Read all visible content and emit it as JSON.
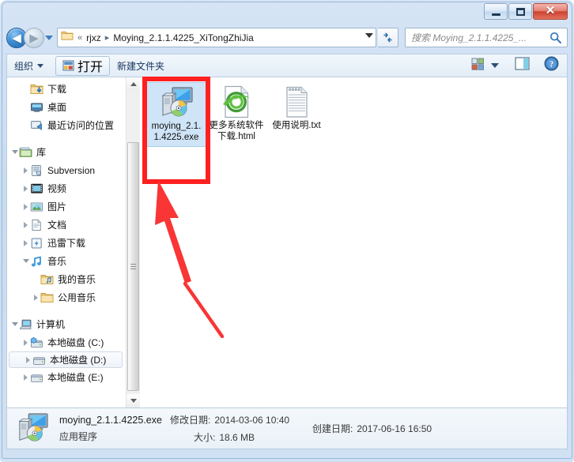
{
  "window": {
    "title": "",
    "controls": {
      "minimize": "minimize-button",
      "maximize": "maximize-button",
      "close": "✕"
    }
  },
  "address_bar": {
    "back_glyph": "◀",
    "forward_glyph": "▶",
    "separator": "«",
    "crumb_sep": "▸",
    "crumbs": [
      "rjxz",
      "Moying_2.1.1.4225_XiTongZhiJia"
    ],
    "refresh_glyph": "↻"
  },
  "search": {
    "placeholder": "搜索 Moying_2.1.1.4225_...",
    "icon": "search-icon"
  },
  "toolbar": {
    "organize_label": "组织",
    "open_label": "打开",
    "new_folder_label": "新建文件夹",
    "view_icon": "view-layout-icon",
    "preview_icon": "preview-pane-icon",
    "help_icon": "help-icon"
  },
  "nav_pane": {
    "items": [
      {
        "label": "下载",
        "icon": "downloads-folder-icon",
        "indent": 2,
        "expander": "none",
        "selected": false
      },
      {
        "label": "桌面",
        "icon": "desktop-icon",
        "indent": 2,
        "expander": "none",
        "selected": false
      },
      {
        "label": "最近访问的位置",
        "icon": "recent-places-icon",
        "indent": 2,
        "expander": "none",
        "selected": false
      },
      {
        "label": "",
        "icon": "",
        "indent": 0,
        "expander": "spacer",
        "selected": false
      },
      {
        "label": "库",
        "icon": "libraries-icon",
        "indent": 1,
        "expander": "open",
        "selected": false
      },
      {
        "label": "Subversion",
        "icon": "subversion-library-icon",
        "indent": 2,
        "expander": "closed",
        "selected": false
      },
      {
        "label": "视频",
        "icon": "videos-library-icon",
        "indent": 2,
        "expander": "closed",
        "selected": false
      },
      {
        "label": "图片",
        "icon": "pictures-library-icon",
        "indent": 2,
        "expander": "closed",
        "selected": false
      },
      {
        "label": "文档",
        "icon": "documents-library-icon",
        "indent": 2,
        "expander": "closed",
        "selected": false
      },
      {
        "label": "迅雷下载",
        "icon": "thunder-download-library-icon",
        "indent": 2,
        "expander": "closed",
        "selected": false
      },
      {
        "label": "音乐",
        "icon": "music-library-icon",
        "indent": 2,
        "expander": "open",
        "selected": false
      },
      {
        "label": "我的音乐",
        "icon": "my-music-folder-icon",
        "indent": 3,
        "expander": "none",
        "selected": false
      },
      {
        "label": "公用音乐",
        "icon": "public-music-folder-icon",
        "indent": 3,
        "expander": "closed",
        "selected": false
      },
      {
        "label": "",
        "icon": "",
        "indent": 0,
        "expander": "spacer",
        "selected": false
      },
      {
        "label": "计算机",
        "icon": "computer-icon",
        "indent": 1,
        "expander": "open",
        "selected": false
      },
      {
        "label": "本地磁盘 (C:)",
        "icon": "system-drive-icon",
        "indent": 2,
        "expander": "closed",
        "selected": false
      },
      {
        "label": "本地磁盘 (D:)",
        "icon": "drive-icon",
        "indent": 2,
        "expander": "closed",
        "selected": true
      },
      {
        "label": "本地磁盘 (E:)",
        "icon": "drive-icon",
        "indent": 2,
        "expander": "closed",
        "selected": false
      }
    ],
    "scrollbar": {
      "up": "scroll-up-arrow",
      "down": "scroll-down-arrow"
    }
  },
  "files": [
    {
      "name": "moying_2.1.1.4225.exe",
      "icon": "application-exe-icon",
      "selected": true
    },
    {
      "name": "更多系统软件下载.html",
      "icon": "internet-explorer-html-icon",
      "selected": false
    },
    {
      "name": "使用说明.txt",
      "icon": "text-file-icon",
      "selected": false
    }
  ],
  "annotations": {
    "highlight_color": "#fe2020",
    "arrow_color": "#f93535",
    "highlight_target": "moying_2.1.1.4225.exe",
    "arrow_points_to": "moying_2.1.1.4225.exe"
  },
  "status_bar": {
    "icon": "application-exe-icon",
    "file_name": "moying_2.1.1.4225.exe",
    "file_type": "应用程序",
    "modified_label": "修改日期:",
    "modified_value": "2014-03-06 10:40",
    "size_label": "大小:",
    "size_value": "18.6 MB",
    "created_label": "创建日期:",
    "created_value": "2017-06-16 16:50"
  }
}
